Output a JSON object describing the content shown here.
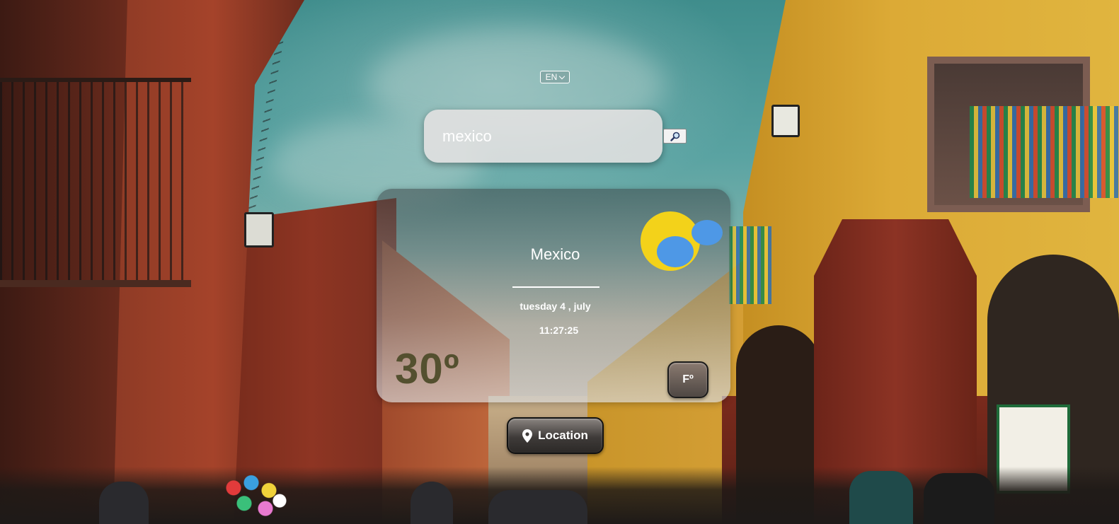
{
  "language": {
    "selected": "EN"
  },
  "search": {
    "value": "mexico",
    "placeholder": ""
  },
  "weather": {
    "city": "Mexico",
    "date": "tuesday 4 , july",
    "time": "11:27:25",
    "temperature": "30º",
    "unit_toggle_label": "Fº",
    "icon": "partly-cloudy-sun-icon"
  },
  "location_button": {
    "label": "Location",
    "icon": "location-pin-icon"
  },
  "colors": {
    "temperature_text": "#54502f",
    "sun": "#f3d21a",
    "cloud": "#4e98e6",
    "button_dark": "#3f3b39"
  }
}
